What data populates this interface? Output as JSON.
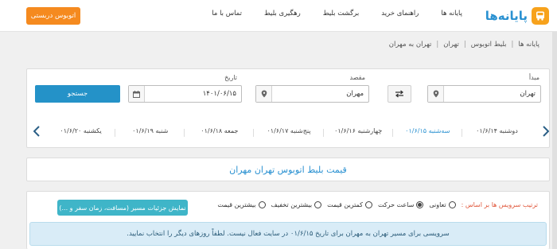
{
  "header": {
    "logo_text": "پایانه‌ها",
    "nav": [
      "پایانه ها",
      "راهنمای خرید",
      "برگشت بلیط",
      "رهگیری بلیط",
      "تماس با ما"
    ],
    "cta_label": "اتوبوس دربستی",
    "accent_color": "#f58a1f",
    "brand_color": "#2a91d1"
  },
  "breadcrumb": [
    "پایانه ها",
    "بلیط اتوبوس",
    "تهران",
    "تهران به مهران"
  ],
  "search": {
    "origin_label": "مبدأ",
    "origin_value": "تهران",
    "destination_label": "مقصد",
    "destination_value": "مهران",
    "date_label": "تاریخ",
    "date_value": "۱۴۰۱/۰۶/۱۵",
    "search_label": "جستجو",
    "swap_icon": "swap-icon",
    "location_icon": "map-pin-icon",
    "calendar_icon": "calendar-icon"
  },
  "dates": [
    "دوشنبه ۰۱/۶/۱۴",
    "سه‌شنبه ۰۱/۶/۱۵",
    "چهارشنبه ۰۱/۶/۱۶",
    "پنج‌شنبه ۰۱/۶/۱۷",
    "جمعه ۰۱/۶/۱۸",
    "شنبه ۰۱/۶/۱۹",
    "یکشنبه ۰۱/۶/۲۰"
  ],
  "active_date_index": 1,
  "page_title": "قیمت بلیط اتوبوس تهران مهران",
  "sort": {
    "label": "ترتیب سرویس ها بر اساس :",
    "options": [
      "تعاونی",
      "ساعت حرکت",
      "کمترین قیمت",
      "بیشترین تخفیف",
      "بیشترین قیمت"
    ],
    "selected_index": 1
  },
  "details_button": "نمایش جزئیات مسیر (مسافت، زمان سفر و ...)",
  "alert_text": "سرویسی برای مسیر تهران به مهران برای تاریخ ۰۱/۶/۱۵ در سایت فعال نیست. لطفاً روزهای دیگر را انتخاب نمایید."
}
